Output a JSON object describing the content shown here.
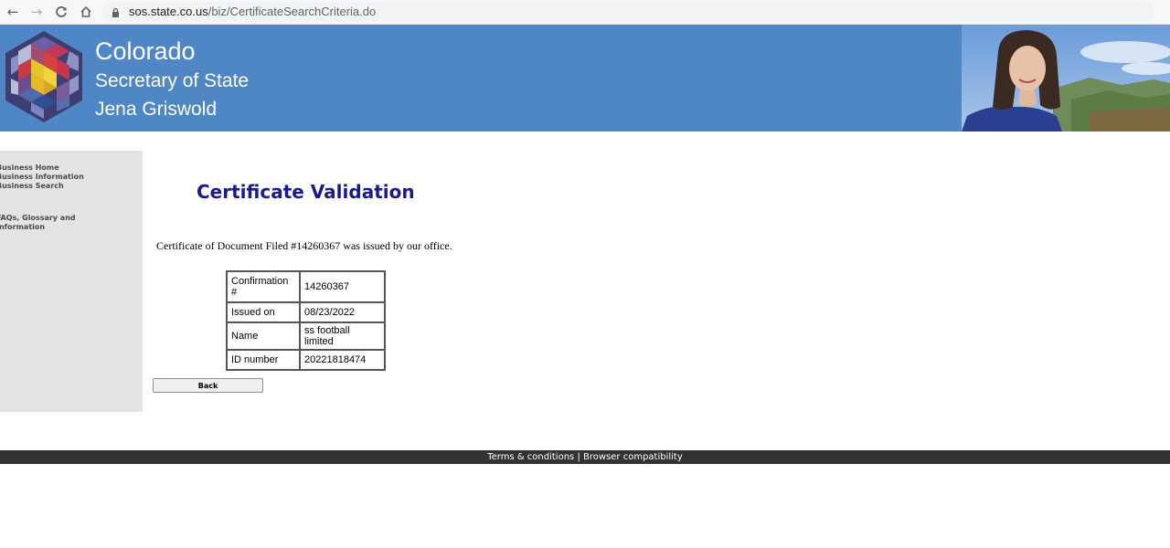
{
  "browser": {
    "url_domain": "sos.state.co.us",
    "url_path": "/biz/CertificateSearchCriteria.do"
  },
  "header": {
    "state": "Colorado",
    "office": "Secretary of State",
    "official": "Jena Griswold"
  },
  "sidebar": {
    "items": [
      "Business Home",
      "Business Information",
      "Business Search",
      "FAQs, Glossary and",
      "Information"
    ]
  },
  "main": {
    "title": "Certificate Validation",
    "intro": "Certificate of Document Filed #14260367 was issued by our office.",
    "table": [
      {
        "label": "Confirmation #",
        "value": "14260367"
      },
      {
        "label": "Issued on",
        "value": "08/23/2022"
      },
      {
        "label": "Name",
        "value": "ss football limited"
      },
      {
        "label": "ID number",
        "value": "20221818474"
      }
    ],
    "back_label": "Back"
  },
  "footer": {
    "terms": "Terms & conditions",
    "separator": "|",
    "compat": "Browser compatibility"
  },
  "colors": {
    "banner": "#4f86c6",
    "title": "#1a1a8c",
    "sidebar": "#e4e4e4",
    "footer": "#333333"
  }
}
